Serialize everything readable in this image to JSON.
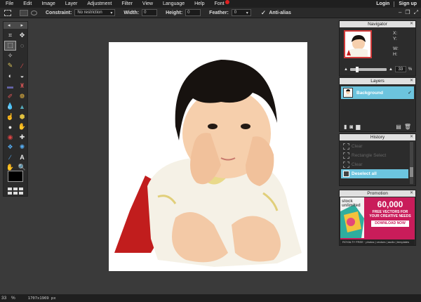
{
  "menubar": {
    "items": [
      "File",
      "Edit",
      "Image",
      "Layer",
      "Adjustment",
      "Filter",
      "View",
      "Language",
      "Help",
      "Font"
    ],
    "login": "Login",
    "signup": "Sign up"
  },
  "options": {
    "constraint_label": "Constraint:",
    "constraint_value": "No restriction",
    "width_label": "Width:",
    "width_value": "0",
    "height_label": "Height:",
    "height_value": "0",
    "feather_label": "Feather:",
    "feather_value": "0",
    "antialias_label": "Anti-alias"
  },
  "navigator": {
    "title": "Navigator",
    "x_label": "X:",
    "y_label": "Y:",
    "w_label": "W:",
    "h_label": "H:",
    "zoom": "33",
    "zoom_unit": "%"
  },
  "layers": {
    "title": "Layers",
    "items": [
      {
        "name": "Background"
      }
    ]
  },
  "history": {
    "title": "History",
    "items": [
      {
        "label": "Clear"
      },
      {
        "label": "Rectangle Select"
      },
      {
        "label": "Clear"
      },
      {
        "label": "Deselect all"
      }
    ]
  },
  "promotion": {
    "title": "Promotion",
    "logo": "stock unlimited",
    "headline": "60,000",
    "subline1": "FREE VECTORS FOR",
    "subline2": "YOUR CREATIVE NEEDS",
    "button": "DOWNLOAD NOW",
    "footer": "ROYALTY FREE · photos | vectors | audio | templates"
  },
  "status": {
    "zoom": "33",
    "zoom_unit": "%",
    "dimensions": "1707x1969 px"
  },
  "colors": {
    "accent": "#6cc4de",
    "menubar": "#1f1f1f",
    "workspace": "#3a3a3a",
    "promo": "#c91c5a"
  }
}
